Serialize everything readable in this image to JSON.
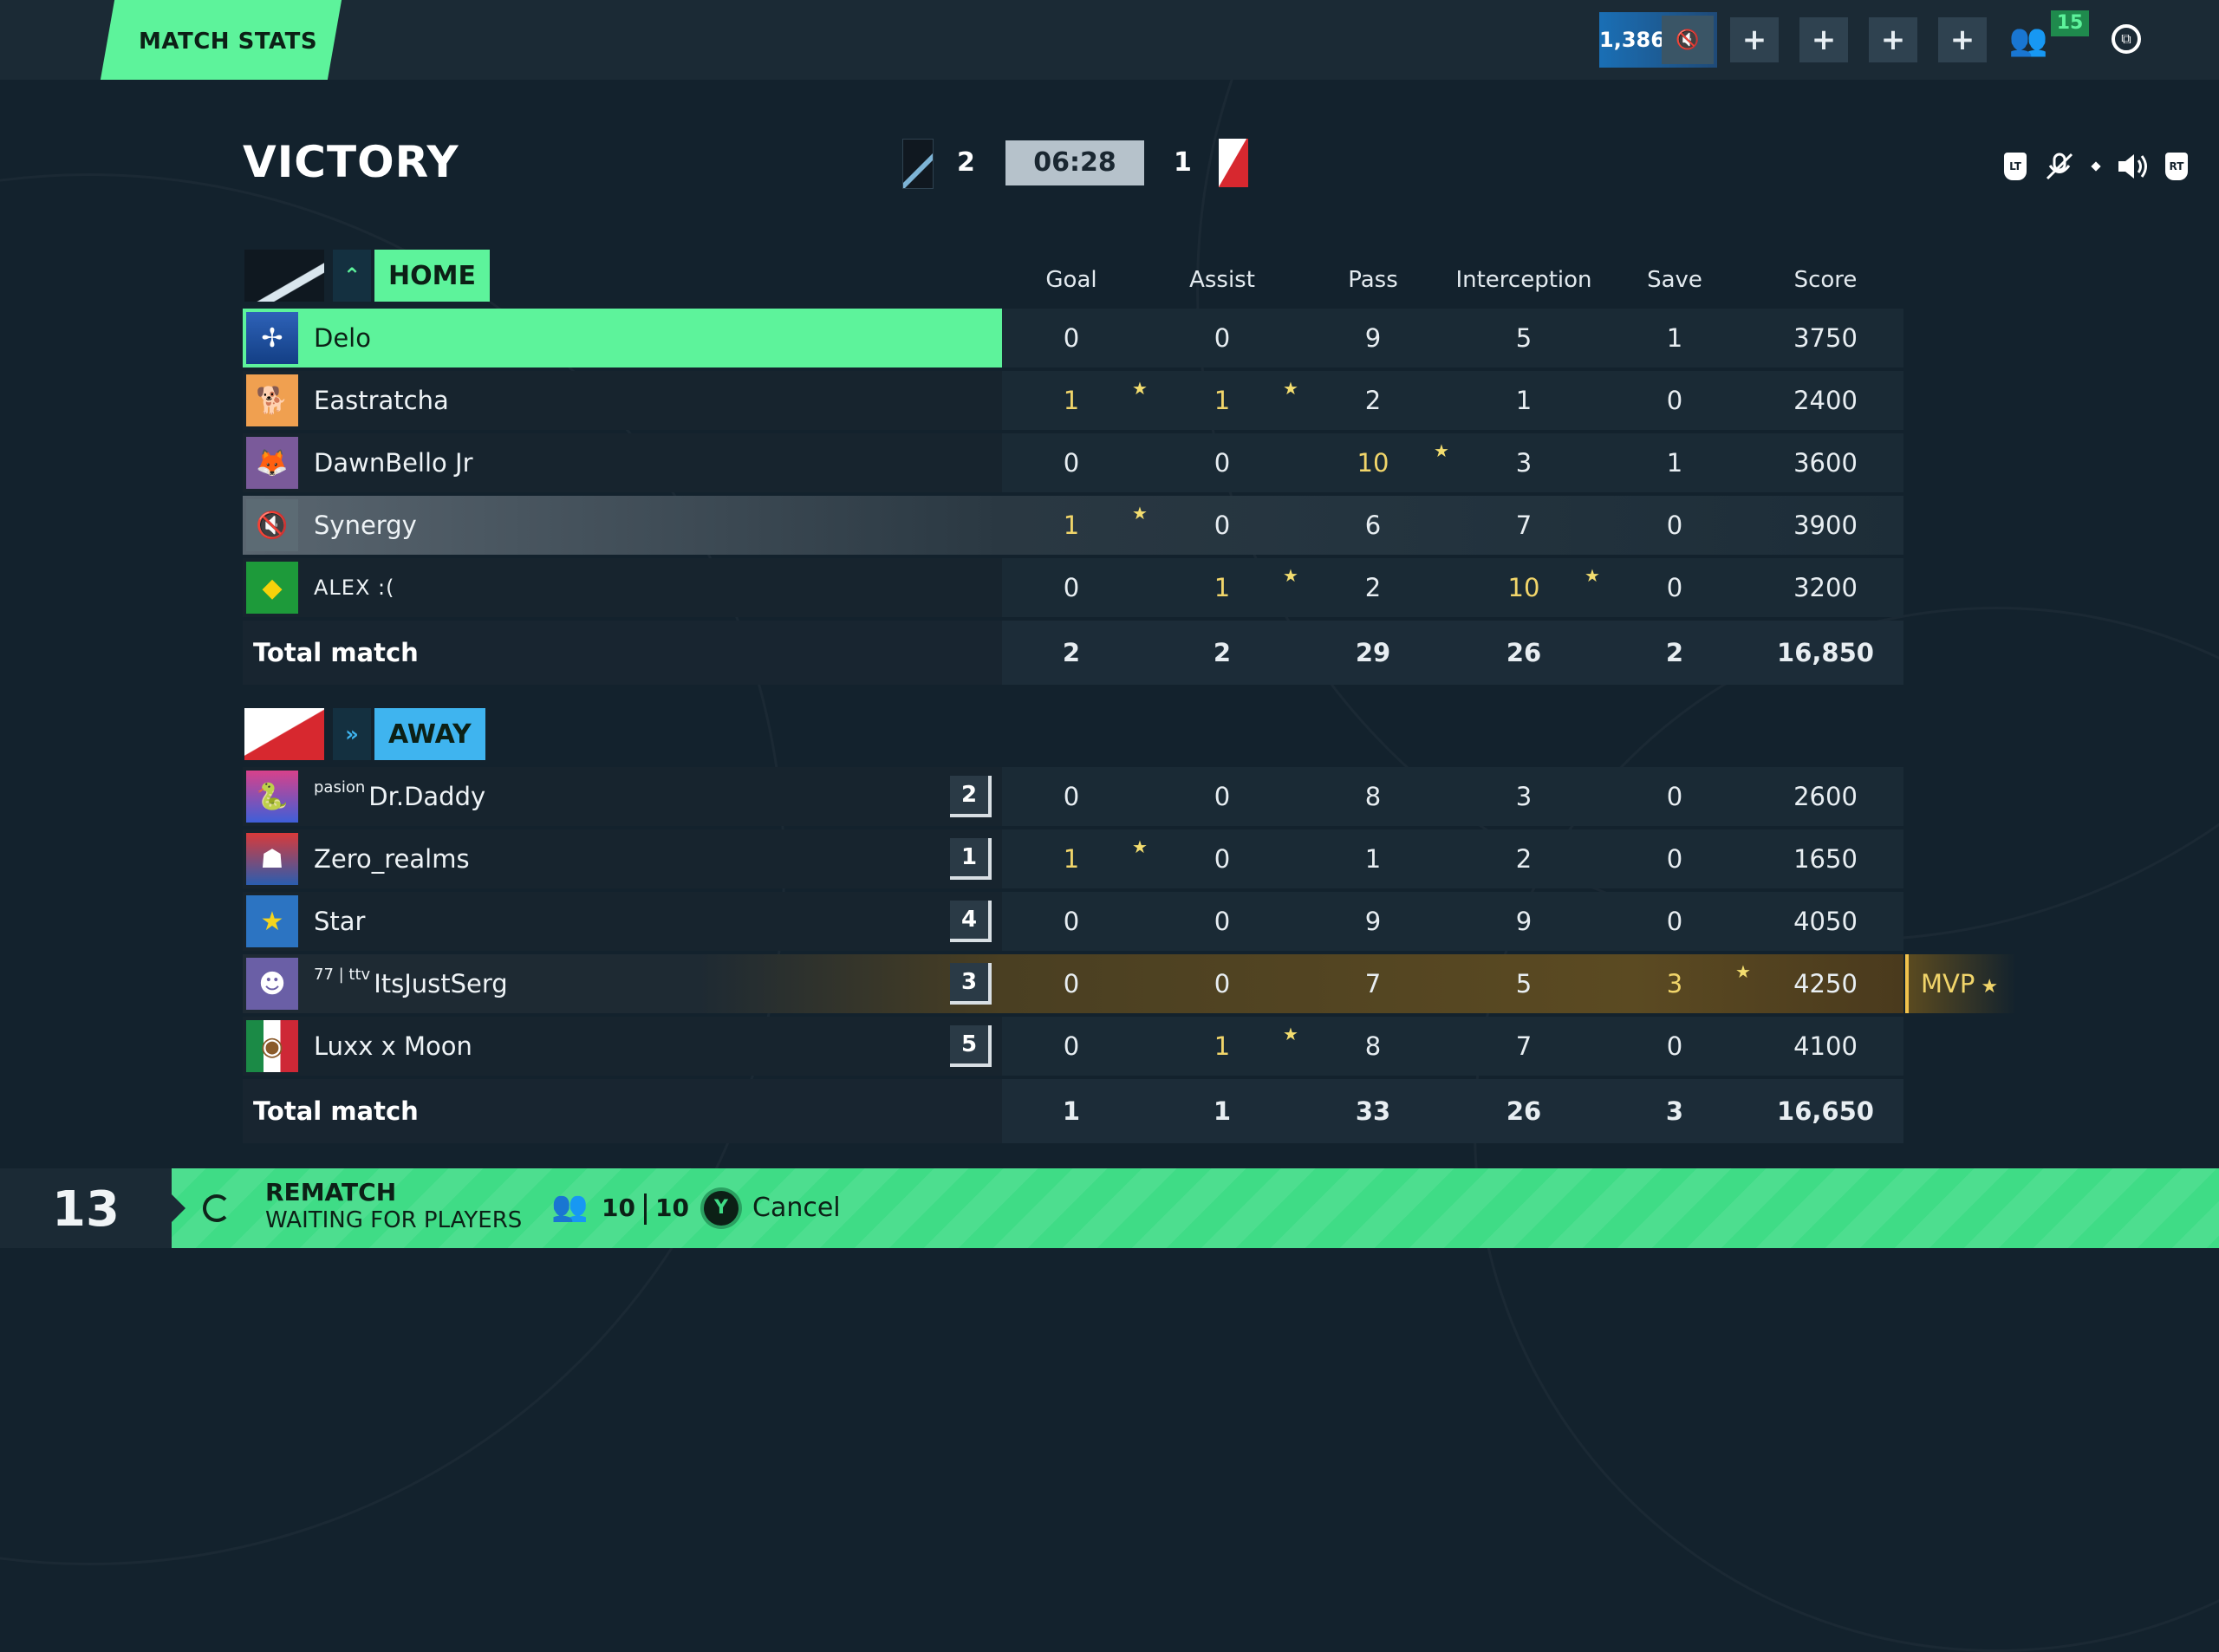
{
  "topbar": {
    "tab_label": "MATCH STATS",
    "coins": "1,386",
    "coin_icon": "muted-speaker-icon",
    "plus_buttons": [
      "+",
      "+",
      "+",
      "+"
    ],
    "friends_count": "15"
  },
  "header": {
    "result": "VICTORY",
    "home_score": "2",
    "timer": "06:28",
    "away_score": "1",
    "controls": {
      "lt": "LT",
      "rt": "RT"
    }
  },
  "columns": [
    "Goal",
    "Assist",
    "Pass",
    "Interception",
    "Save",
    "Score"
  ],
  "home": {
    "name": "HOME",
    "accent": "#5df39b",
    "players": [
      {
        "name": "Delo",
        "prefix": "",
        "stats": [
          "0",
          "0",
          "9",
          "5",
          "1",
          "3750"
        ],
        "best": [],
        "highlight": "selected",
        "avatar": "wind-turbine-avatar"
      },
      {
        "name": "Eastratcha",
        "prefix": "",
        "stats": [
          "1",
          "1",
          "2",
          "1",
          "0",
          "2400"
        ],
        "best": [
          0,
          1
        ],
        "highlight": "",
        "avatar": "shiba-avatar"
      },
      {
        "name": "DawnBello Jr",
        "prefix": "",
        "stats": [
          "0",
          "0",
          "10",
          "3",
          "1",
          "3600"
        ],
        "best": [
          2
        ],
        "highlight": "",
        "avatar": "fox-avatar"
      },
      {
        "name": "Synergy",
        "prefix": "",
        "stats": [
          "1",
          "0",
          "6",
          "7",
          "0",
          "3900"
        ],
        "best": [
          0
        ],
        "highlight": "self",
        "avatar": "muted-speaker-avatar"
      },
      {
        "name": "ALEX :(",
        "prefix": "",
        "stats": [
          "0",
          "1",
          "2",
          "10",
          "0",
          "3200"
        ],
        "best": [
          1,
          3
        ],
        "highlight": "",
        "avatar": "brazil-flag-avatar"
      }
    ],
    "total_label": "Total match",
    "totals": [
      "2",
      "2",
      "29",
      "26",
      "2",
      "16,850"
    ]
  },
  "away": {
    "name": "AWAY",
    "accent": "#3fb4ef",
    "players": [
      {
        "name": "Dr.Daddy",
        "prefix": "pasion",
        "rank": "2",
        "stats": [
          "0",
          "0",
          "8",
          "3",
          "0",
          "2600"
        ],
        "best": [],
        "highlight": "",
        "avatar": "cobra-avatar"
      },
      {
        "name": "Zero_realms",
        "prefix": "",
        "rank": "1",
        "stats": [
          "1",
          "0",
          "1",
          "2",
          "0",
          "1650"
        ],
        "best": [
          0
        ],
        "highlight": "",
        "avatar": "red-hero-avatar"
      },
      {
        "name": "Star",
        "prefix": "",
        "rank": "4",
        "stats": [
          "0",
          "0",
          "9",
          "9",
          "0",
          "4050"
        ],
        "best": [],
        "highlight": "",
        "avatar": "star-avatar"
      },
      {
        "name": "ItsJustSerg",
        "prefix": "77 | ttv",
        "rank": "3",
        "stats": [
          "0",
          "0",
          "7",
          "5",
          "3",
          "4250"
        ],
        "best": [
          4
        ],
        "highlight": "mvp",
        "avatar": "robot-avatar"
      },
      {
        "name": "Luxx x Moon",
        "prefix": "",
        "rank": "5",
        "stats": [
          "0",
          "1",
          "8",
          "7",
          "0",
          "4100"
        ],
        "best": [
          1
        ],
        "highlight": "",
        "avatar": "mexico-flag-avatar"
      }
    ],
    "total_label": "Total match",
    "totals": [
      "1",
      "1",
      "33",
      "26",
      "3",
      "16,650"
    ],
    "mvp_label": "MVP"
  },
  "bottom": {
    "countdown": "13",
    "rematch_label": "REMATCH",
    "status": "WAITING FOR PLAYERS",
    "players_ready": "10",
    "players_total": "10",
    "cancel_button_glyph": "Y",
    "cancel_label": "Cancel"
  }
}
